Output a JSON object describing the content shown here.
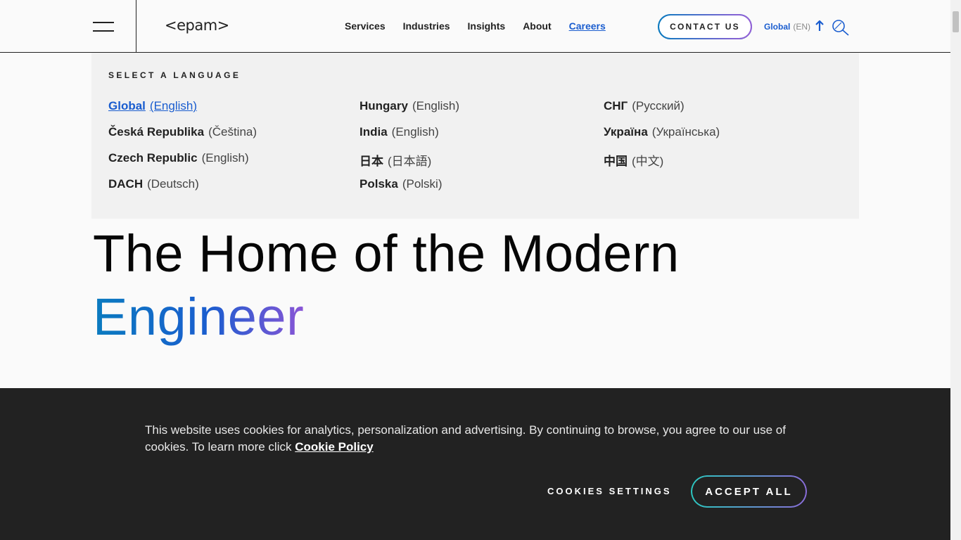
{
  "header": {
    "logo": "<epam>",
    "nav": [
      "Services",
      "Industries",
      "Insights",
      "About",
      "Careers"
    ],
    "active_nav": "Careers",
    "contact_label": "CONTACT US",
    "lang_label": "Global",
    "lang_code": "(EN)"
  },
  "lang_panel": {
    "title": "SELECT A LANGUAGE",
    "col1": [
      {
        "country": "Global",
        "lang": "(English)",
        "selected": true
      },
      {
        "country": "Česká Republika",
        "lang": "(Čeština)"
      },
      {
        "country": "Czech Republic",
        "lang": "(English)"
      },
      {
        "country": "DACH",
        "lang": "(Deutsch)"
      }
    ],
    "col2": [
      {
        "country": "Hungary",
        "lang": "(English)"
      },
      {
        "country": "India",
        "lang": "(English)"
      },
      {
        "country": "日本",
        "lang": "(日本語)"
      },
      {
        "country": "Polska",
        "lang": "(Polski)"
      }
    ],
    "col3": [
      {
        "country": "СНГ",
        "lang": "(Русский)"
      },
      {
        "country": "Україна",
        "lang": "(Українська)"
      },
      {
        "country": "中国",
        "lang": "(中文)"
      }
    ]
  },
  "hero": {
    "line1": "The Home of the Modern",
    "line2": "Engineer"
  },
  "cookie": {
    "text": "This website uses cookies for analytics, personalization and advertising. By continuing to browse, you agree to our use of cookies. To learn more click ",
    "policy_link": "Cookie Policy",
    "settings_label": "COOKIES SETTINGS",
    "accept_label": "ACCEPT ALL"
  },
  "colors": {
    "accent": "#1a5dcf",
    "banner_bg": "#222222"
  }
}
